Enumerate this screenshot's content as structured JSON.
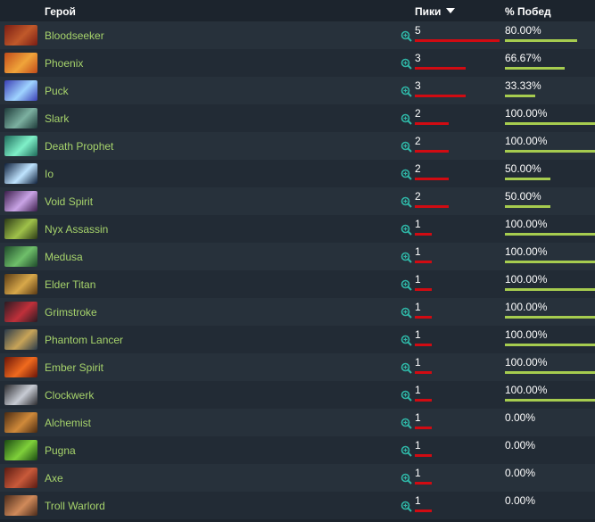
{
  "header": {
    "hero_label": "Герой",
    "picks_label": "Пики",
    "win_label": "% Побед"
  },
  "max_picks": 5,
  "rows": [
    {
      "hero": "Bloodseeker",
      "picks": "5",
      "win": "80.00%",
      "win_value": 80.0,
      "avatar_colors": [
        "#7a1d14",
        "#c0592a"
      ]
    },
    {
      "hero": "Phoenix",
      "picks": "3",
      "win": "66.67%",
      "win_value": 66.67,
      "avatar_colors": [
        "#c14b1a",
        "#f0a43a"
      ]
    },
    {
      "hero": "Puck",
      "picks": "3",
      "win": "33.33%",
      "win_value": 33.33,
      "avatar_colors": [
        "#3b3fb5",
        "#9fd3ff"
      ]
    },
    {
      "hero": "Slark",
      "picks": "2",
      "win": "100.00%",
      "win_value": 100.0,
      "avatar_colors": [
        "#1e3b3a",
        "#7cb0a0"
      ]
    },
    {
      "hero": "Death Prophet",
      "picks": "2",
      "win": "100.00%",
      "win_value": 100.0,
      "avatar_colors": [
        "#1e6a5a",
        "#7ff0c8"
      ]
    },
    {
      "hero": "Io",
      "picks": "2",
      "win": "50.00%",
      "win_value": 50.0,
      "avatar_colors": [
        "#0e1f3a",
        "#bfe4ff"
      ]
    },
    {
      "hero": "Void Spirit",
      "picks": "2",
      "win": "50.00%",
      "win_value": 50.0,
      "avatar_colors": [
        "#3b1d4a",
        "#c9a4e6"
      ]
    },
    {
      "hero": "Nyx Assassin",
      "picks": "1",
      "win": "100.00%",
      "win_value": 100.0,
      "avatar_colors": [
        "#2c3a16",
        "#9fc14a"
      ]
    },
    {
      "hero": "Medusa",
      "picks": "1",
      "win": "100.00%",
      "win_value": 100.0,
      "avatar_colors": [
        "#1e4a2a",
        "#6fbf6a"
      ]
    },
    {
      "hero": "Elder Titan",
      "picks": "1",
      "win": "100.00%",
      "win_value": 100.0,
      "avatar_colors": [
        "#5a3a14",
        "#d8a84a"
      ]
    },
    {
      "hero": "Grimstroke",
      "picks": "1",
      "win": "100.00%",
      "win_value": 100.0,
      "avatar_colors": [
        "#2a1a22",
        "#c0303a"
      ]
    },
    {
      "hero": "Phantom Lancer",
      "picks": "1",
      "win": "100.00%",
      "win_value": 100.0,
      "avatar_colors": [
        "#2a3a4a",
        "#c8a458"
      ]
    },
    {
      "hero": "Ember Spirit",
      "picks": "1",
      "win": "100.00%",
      "win_value": 100.0,
      "avatar_colors": [
        "#6a1408",
        "#f06a1e"
      ]
    },
    {
      "hero": "Clockwerk",
      "picks": "1",
      "win": "100.00%",
      "win_value": 100.0,
      "avatar_colors": [
        "#2a2a2e",
        "#c8ccd4"
      ]
    },
    {
      "hero": "Alchemist",
      "picks": "1",
      "win": "0.00%",
      "win_value": 0.0,
      "avatar_colors": [
        "#4a2a12",
        "#d08a3a"
      ]
    },
    {
      "hero": "Pugna",
      "picks": "1",
      "win": "0.00%",
      "win_value": 0.0,
      "avatar_colors": [
        "#1a4a12",
        "#7fd03a"
      ]
    },
    {
      "hero": "Axe",
      "picks": "1",
      "win": "0.00%",
      "win_value": 0.0,
      "avatar_colors": [
        "#5a1a12",
        "#c85a3a"
      ]
    },
    {
      "hero": "Troll Warlord",
      "picks": "1",
      "win": "0.00%",
      "win_value": 0.0,
      "avatar_colors": [
        "#4a2a1a",
        "#d08a5a"
      ]
    }
  ],
  "colors": {
    "hero_name": "#a6d36b",
    "picks_bar": "#d10b12",
    "win_bar": "#a6cc4f",
    "zoom_icon": "#2fb8a8"
  },
  "icons": {
    "zoom": "magnifier-plus-icon"
  }
}
